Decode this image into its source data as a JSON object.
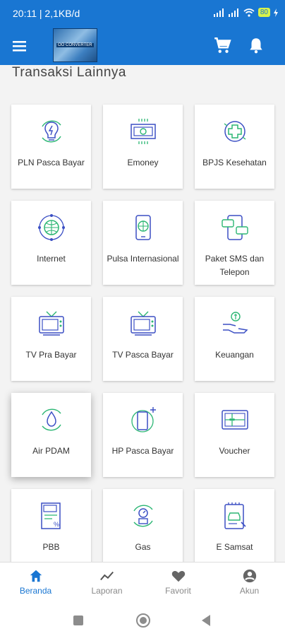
{
  "status_bar": {
    "time": "20:11 | 2,1KB/d",
    "battery": "80"
  },
  "app_bar": {
    "logo_text": "OO CONVERTER"
  },
  "section_title": "Transaksi Lainnya",
  "tiles": [
    {
      "label": "PLN Pasca Bayar",
      "icon": "electricity-bulb-icon"
    },
    {
      "label": "Emoney",
      "icon": "money-card-icon"
    },
    {
      "label": "BPJS Kesehatan",
      "icon": "health-cross-icon"
    },
    {
      "label": "Internet",
      "icon": "globe-network-icon"
    },
    {
      "label": "Pulsa Internasional",
      "icon": "phone-globe-icon"
    },
    {
      "label": "Paket SMS dan Telepon",
      "icon": "phone-chat-icon"
    },
    {
      "label": "TV Pra Bayar",
      "icon": "tv-icon"
    },
    {
      "label": "TV Pasca Bayar",
      "icon": "tv-icon"
    },
    {
      "label": "Keuangan",
      "icon": "hand-money-icon"
    },
    {
      "label": "Air PDAM",
      "icon": "water-drop-icon"
    },
    {
      "label": "HP Pasca Bayar",
      "icon": "phone-plus-icon"
    },
    {
      "label": "Voucher",
      "icon": "gift-voucher-icon"
    },
    {
      "label": "PBB",
      "icon": "tax-document-icon"
    },
    {
      "label": "Gas",
      "icon": "gas-meter-icon"
    },
    {
      "label": "E Samsat",
      "icon": "car-document-icon"
    }
  ],
  "bottom_nav": [
    {
      "label": "Beranda",
      "icon": "home-icon",
      "active": true
    },
    {
      "label": "Laporan",
      "icon": "chart-line-icon",
      "active": false
    },
    {
      "label": "Favorit",
      "icon": "heart-icon",
      "active": false
    },
    {
      "label": "Akun",
      "icon": "account-icon",
      "active": false
    }
  ],
  "colors": {
    "primary": "#1976d2",
    "accent_green": "#2bb673",
    "icon_blue": "#3b4fc4"
  }
}
